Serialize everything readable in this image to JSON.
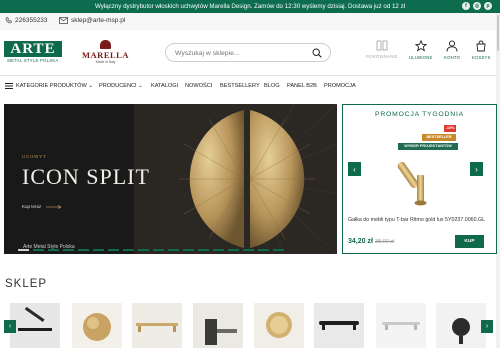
{
  "topbar": {
    "message": "Wyłączny dystrybutor włoskich uchwytów Marella Design. Zamów do 12:30 wyślemy dzisiaj. Dostawa już od 12 zł",
    "social": [
      "f",
      "◎",
      "p"
    ]
  },
  "contact": {
    "phone": "226355233",
    "email": "sklep@arte-msp.pl"
  },
  "logo": {
    "arte": "ARTE",
    "arte_sub": "METAL STYLE POLSKA",
    "marella": "MARELLA",
    "marella_sub": "Made in Italy"
  },
  "search": {
    "placeholder": "Wyszukaj w sklepie..."
  },
  "header_icons": [
    {
      "label": "PORÓWNANIE",
      "icon": "compare-icon"
    },
    {
      "label": "ULUBIONE",
      "icon": "star-icon"
    },
    {
      "label": "KONTO",
      "icon": "user-icon"
    },
    {
      "label": "KOSZYK",
      "icon": "cart-icon"
    }
  ],
  "nav": {
    "categories": "KATEGORIE PRODUKTÓW",
    "items": [
      "PRODUCENCI",
      "KATALOGI",
      "NOWOŚCI",
      "BESTSELLERY",
      "BLOG",
      "PANEL B2B",
      "PROMOCJA"
    ]
  },
  "hero": {
    "kicker": "UCHWYT",
    "title": "ICON SPLIT",
    "cta": "Kup teraz",
    "caption": "Arte Metal Style Polska",
    "colors": {
      "accent": "#0d6b4e",
      "gold": "#b38b55"
    }
  },
  "promo": {
    "header": "PROMOCJA TYGODNIA",
    "badges": {
      "discount": "-10%",
      "bestseller": "BESTSELLER",
      "designer": "WYBÓR PROJEKTANTÓW"
    },
    "product_name": "Gałka do mebli typu T-bar Ritmo gold lux 5Y0237.0060.GL",
    "price": "34,20 zł",
    "old_price": "38,00 zł",
    "buy": "KUP"
  },
  "section": {
    "title": "SKLEP"
  }
}
